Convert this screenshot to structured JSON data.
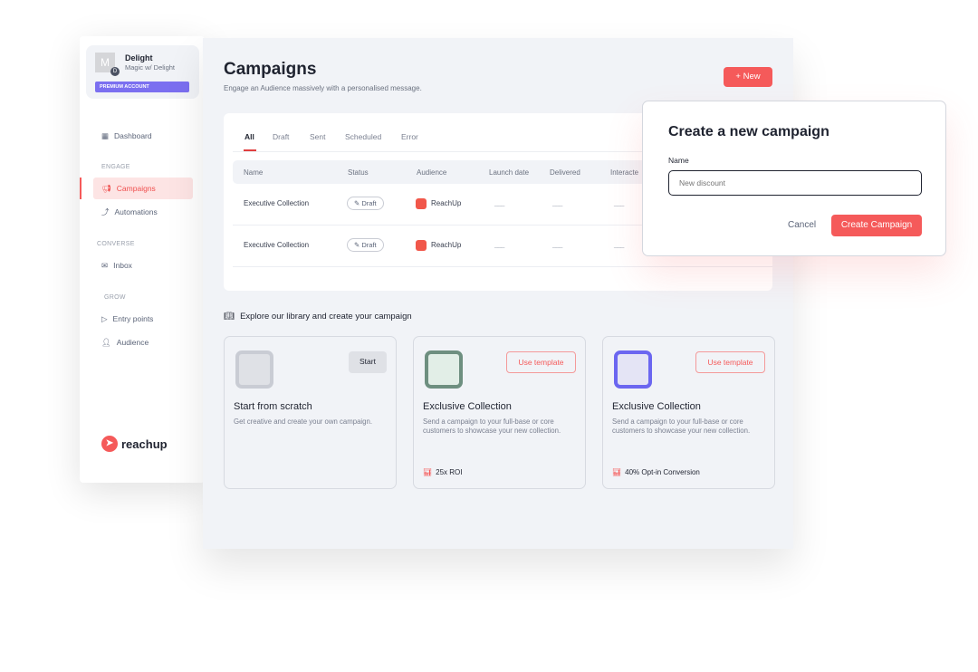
{
  "sidebar": {
    "profile": {
      "initial": "M",
      "badge": "D",
      "name": "Delight",
      "subtitle": "Magic w/ Delight",
      "plan": "PREMIUM ACCOUNT"
    },
    "dashboard": "Dashboard",
    "sections": {
      "engage": "ENGAGE",
      "converse": "CONVERSE",
      "grow": "GROW"
    },
    "items": {
      "campaigns": "Campaigns",
      "automations": "Automations",
      "inbox": "Inbox",
      "entry_points": "Entry points",
      "audience": "Audience"
    },
    "logo": "reachup"
  },
  "main": {
    "title": "Campaigns",
    "subtitle": "Engage an Audience massively with a personalised message.",
    "new_label": "New",
    "tabs": [
      "All",
      "Draft",
      "Sent",
      "Scheduled",
      "Error"
    ],
    "active_tab": "All",
    "columns": [
      "Name",
      "Status",
      "Audience",
      "Launch date",
      "Delivered",
      "Interacte"
    ],
    "rows": [
      {
        "name": "Executive Collection",
        "status": "Draft",
        "audience": "ReachUp",
        "launch": "___",
        "delivered": "___",
        "interacted": "___"
      },
      {
        "name": "Executive Collection",
        "status": "Draft",
        "audience": "ReachUp",
        "launch": "___",
        "delivered": "___",
        "interacted": "___"
      }
    ],
    "library_title": "Explore our library and create your campaign",
    "cards": [
      {
        "title": "Start from scratch",
        "desc": "Get creative and create your own campaign.",
        "button": "Start",
        "stat": ""
      },
      {
        "title": "Exclusive Collection",
        "desc": "Send a campaign to your full-base or core customers to showcase your new collection.",
        "button": "Use template",
        "stat": "25x ROI"
      },
      {
        "title": "Exclusive Collection",
        "desc": "Send a campaign to your full-base or core customers to showcase your new collection.",
        "button": "Use template",
        "stat": "40% Opt-in Conversion"
      }
    ]
  },
  "modal": {
    "title": "Create a new campaign",
    "name_label": "Name",
    "placeholder": "New discount",
    "value": "",
    "cancel": "Cancel",
    "create": "Create Campaign"
  },
  "colors": {
    "accent": "#f55a5a",
    "premium": "#7b6ff0",
    "background": "#f1f3f7"
  }
}
